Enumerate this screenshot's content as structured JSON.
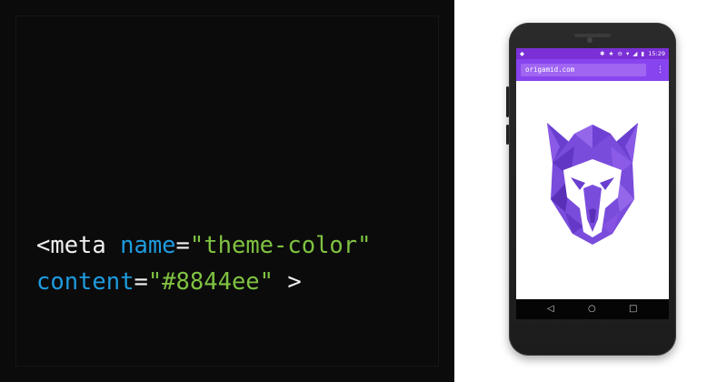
{
  "code": {
    "line1": {
      "tag": "<meta",
      "attr": "name",
      "eq": "=",
      "value": "\"theme-color\""
    },
    "line2": {
      "attr": "content",
      "eq": "=",
      "value": "\"#8844ee\"",
      "close": ">"
    }
  },
  "phone": {
    "status_time": "15:29",
    "status_icons": "✱ ★ ⊖ ▾ ◢ ▮",
    "status_left_icon": "◆",
    "url": "origamid.com",
    "menu_icon": "⋮",
    "nav_back": "◁",
    "nav_home": "○",
    "nav_recent": "□",
    "theme_color": "#8844ee",
    "logo": "wolf-logo"
  }
}
